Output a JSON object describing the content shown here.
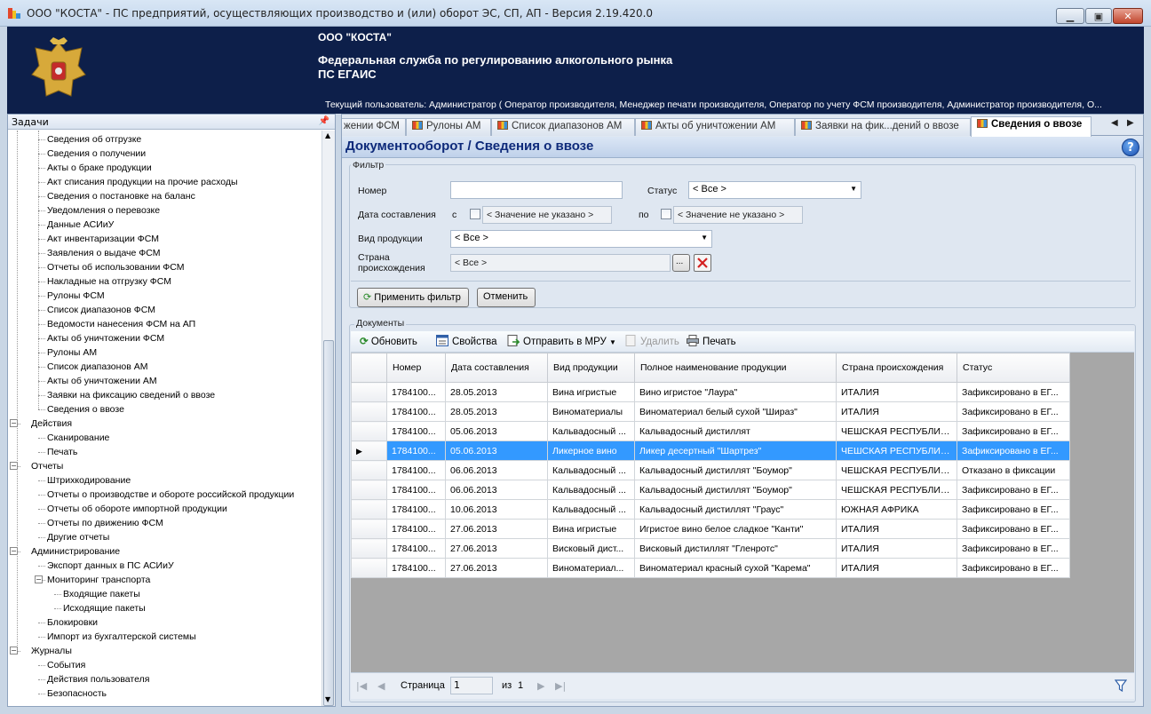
{
  "window": {
    "title": "ООО \"КОСТА\" - ПС предприятий, осуществляющих производство и (или) оборот ЭС, СП, АП - Версия 2.19.420.0"
  },
  "banner": {
    "org": "ООО \"КОСТА\"",
    "service": "Федеральная служба по регулированию алкогольного рынка",
    "system": "ПС ЕГАИС",
    "current_user": "Текущий пользователь: Администратор ( Оператор производителя, Менеджер печати производителя, Оператор по учету ФСМ производителя, Администратор производителя, О..."
  },
  "tasks": {
    "header": "Задачи",
    "items": [
      {
        "label": "Сведения об отгрузке",
        "level": 2
      },
      {
        "label": "Сведения о получении",
        "level": 2
      },
      {
        "label": "Акты о браке продукции",
        "level": 2
      },
      {
        "label": "Акт списания продукции на прочие расходы",
        "level": 2
      },
      {
        "label": "Сведения о постановке на баланс",
        "level": 2
      },
      {
        "label": "Уведомления о перевозке",
        "level": 2
      },
      {
        "label": "Данные АСИиУ",
        "level": 2
      },
      {
        "label": "Акт инвентаризации ФСМ",
        "level": 2
      },
      {
        "label": "Заявления о выдаче ФСМ",
        "level": 2
      },
      {
        "label": "Отчеты об использовании ФСМ",
        "level": 2
      },
      {
        "label": "Накладные на отгрузку ФСМ",
        "level": 2
      },
      {
        "label": "Рулоны ФСМ",
        "level": 2
      },
      {
        "label": "Список диапазонов ФСМ",
        "level": 2
      },
      {
        "label": "Ведомости нанесения ФСМ на АП",
        "level": 2
      },
      {
        "label": "Акты об уничтожении ФСМ",
        "level": 2
      },
      {
        "label": "Рулоны АМ",
        "level": 2
      },
      {
        "label": "Список диапазонов АМ",
        "level": 2
      },
      {
        "label": "Акты об уничтожении АМ",
        "level": 2
      },
      {
        "label": "Заявки на фиксацию сведений о ввозе",
        "level": 2
      },
      {
        "label": "Сведения о ввозе",
        "level": 2
      },
      {
        "label": "Действия",
        "level": 1,
        "expander": "−"
      },
      {
        "label": "Сканирование",
        "level": 2
      },
      {
        "label": "Печать",
        "level": 2
      },
      {
        "label": "Отчеты",
        "level": 1,
        "expander": "−"
      },
      {
        "label": "Штрихкодирование",
        "level": 2
      },
      {
        "label": "Отчеты о производстве и обороте российской продукции",
        "level": 2
      },
      {
        "label": "Отчеты об обороте импортной продукции",
        "level": 2
      },
      {
        "label": "Отчеты по движению ФСМ",
        "level": 2
      },
      {
        "label": "Другие отчеты",
        "level": 2
      },
      {
        "label": "Администрирование",
        "level": 1,
        "expander": "−"
      },
      {
        "label": "Экспорт данных в ПС АСИиУ",
        "level": 2
      },
      {
        "label": "Мониторинг транспорта",
        "level": 2,
        "expander": "−"
      },
      {
        "label": "Входящие пакеты",
        "level": 3
      },
      {
        "label": "Исходящие пакеты",
        "level": 3
      },
      {
        "label": "Блокировки",
        "level": 2
      },
      {
        "label": "Импорт из бухгалтерской системы",
        "level": 2
      },
      {
        "label": "Журналы",
        "level": 1,
        "expander": "−"
      },
      {
        "label": "События",
        "level": 2
      },
      {
        "label": "Действия пользователя",
        "level": 2
      },
      {
        "label": "Безопасность",
        "level": 2
      }
    ]
  },
  "tabs": [
    {
      "label": "жении ФСМ"
    },
    {
      "label": "Рулоны АМ"
    },
    {
      "label": "Список диапазонов АМ"
    },
    {
      "label": "Акты об уничтожении АМ"
    },
    {
      "label": "Заявки на фик...дений о ввозе"
    },
    {
      "label": "Сведения о ввозе",
      "active": true
    }
  ],
  "page": {
    "title": "Документооборот / Сведения о ввозе"
  },
  "filter": {
    "legend": "Фильтр",
    "number_label": "Номер",
    "number_value": "",
    "status_label": "Статус",
    "status_value": "< Все >",
    "date_label": "Дата составления",
    "date_from_prefix": "с",
    "date_from": "< Значение не указано >",
    "date_to_prefix": "по",
    "date_to": "< Значение не указано >",
    "product_type_label": "Вид продукции",
    "product_type_value": "< Все >",
    "country_label": "Страна происхождения",
    "country_value": "< Все >",
    "browse_label": "...",
    "apply_label": "Применить фильтр",
    "cancel_label": "Отменить"
  },
  "documents": {
    "legend": "Документы",
    "toolbar": {
      "refresh": "Обновить",
      "properties": "Свойства",
      "send": "Отправить в МРУ",
      "delete": "Удалить",
      "print": "Печать"
    },
    "columns": [
      "Номер",
      "Дата составления",
      "Вид продукции",
      "Полное наименование продукции",
      "Страна происхождения",
      "Статус"
    ],
    "rows": [
      [
        "1784100...",
        "28.05.2013",
        "Вина игристые",
        "Вино игристое \"Лаура\"",
        "ИТАЛИЯ",
        "Зафиксировано в ЕГ..."
      ],
      [
        "1784100...",
        "28.05.2013",
        "Виноматериалы",
        "Виноматериал белый сухой \"Шираз\"",
        "ИТАЛИЯ",
        "Зафиксировано в ЕГ..."
      ],
      [
        "1784100...",
        "05.06.2013",
        "Кальвадосный ...",
        "Кальвадосный дистиллят",
        "ЧЕШСКАЯ РЕСПУБЛИКА",
        "Зафиксировано в ЕГ..."
      ],
      [
        "1784100...",
        "05.06.2013",
        "Ликерное вино",
        "Ликер десертный \"Шартрез\"",
        "ЧЕШСКАЯ РЕСПУБЛИКА",
        "Зафиксировано в ЕГ..."
      ],
      [
        "1784100...",
        "06.06.2013",
        "Кальвадосный ...",
        "Кальвадосный дистиллят \"Боумор\"",
        "ЧЕШСКАЯ РЕСПУБЛИКА",
        "Отказано в фиксации"
      ],
      [
        "1784100...",
        "06.06.2013",
        "Кальвадосный ...",
        "Кальвадосный дистиллят \"Боумор\"",
        "ЧЕШСКАЯ РЕСПУБЛИКА",
        "Зафиксировано в ЕГ..."
      ],
      [
        "1784100...",
        "10.06.2013",
        "Кальвадосный ...",
        "Кальвадосный дистиллят \"Граус\"",
        "ЮЖНАЯ АФРИКА",
        "Зафиксировано в ЕГ..."
      ],
      [
        "1784100...",
        "27.06.2013",
        "Вина игристые",
        "Игристое вино белое сладкое \"Канти\"",
        "ИТАЛИЯ",
        "Зафиксировано в ЕГ..."
      ],
      [
        "1784100...",
        "27.06.2013",
        "Висковый дист...",
        "Висковый дистиллят \"Гленротс\"",
        "ИТАЛИЯ",
        "Зафиксировано в ЕГ..."
      ],
      [
        "1784100...",
        "27.06.2013",
        "Виноматериал...",
        "Виноматериал красный сухой \"Карема\"",
        "ИТАЛИЯ",
        "Зафиксировано в ЕГ..."
      ]
    ],
    "selected_row": 3,
    "pager": {
      "page_label": "Страница",
      "page_value": "1",
      "of_label": "из",
      "total": "1"
    }
  }
}
